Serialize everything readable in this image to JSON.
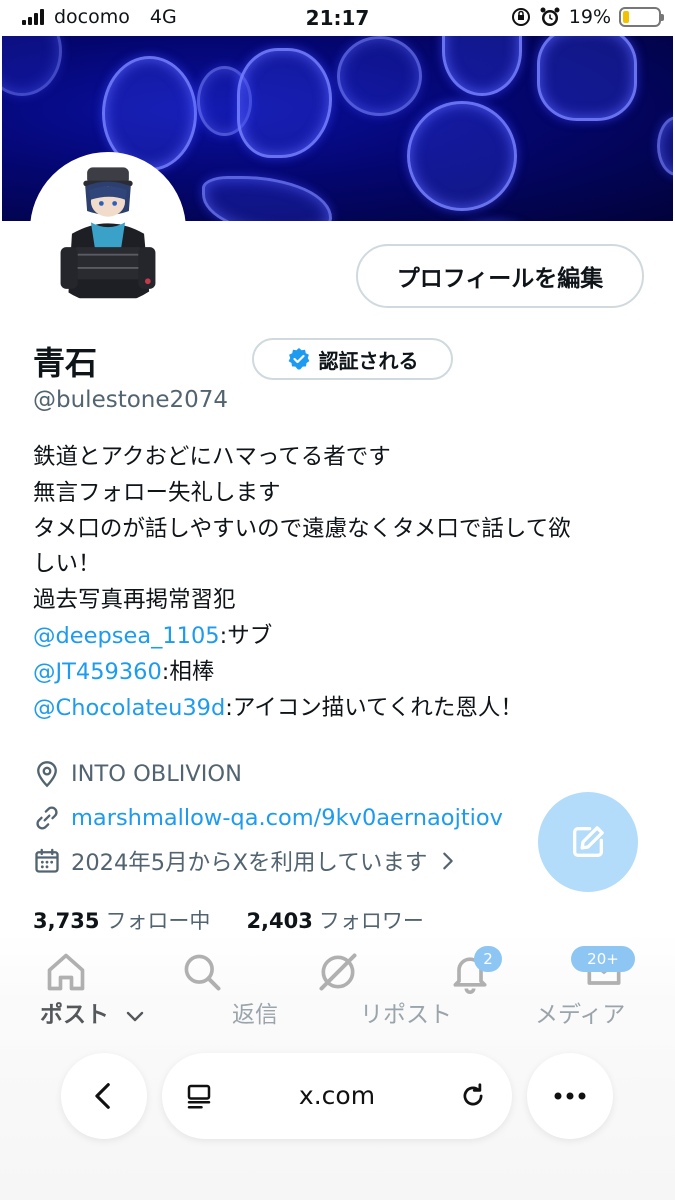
{
  "status_bar": {
    "carrier": "docomo",
    "network": "4G",
    "time": "21:17",
    "battery_percent": "19%",
    "battery_level": 0.19
  },
  "profile": {
    "edit_button": "プロフィールを編集",
    "name": "青石",
    "verify_button": "認証される",
    "handle": "@bulestone2074",
    "bio_lines": [
      [
        {
          "text": "鉄道とアクおどにハマってる者です"
        }
      ],
      [
        {
          "text": "無言フォロー失礼します"
        }
      ],
      [
        {
          "text": "タメ口のが話しやすいので遠慮なくタメ口で話して欲"
        }
      ],
      [
        {
          "text": "しい！"
        }
      ],
      [
        {
          "text": "過去写真再掲常習犯"
        }
      ],
      [
        {
          "text": "@deepsea_1105",
          "mention": true
        },
        {
          "text": ":サブ"
        }
      ],
      [
        {
          "text": "@JT459360",
          "mention": true
        },
        {
          "text": ":相棒"
        }
      ],
      [
        {
          "text": "@Chocolateu39d",
          "mention": true
        },
        {
          "text": ":アイコン描いてくれた恩人！"
        }
      ]
    ],
    "location": "INTO OBLIVION",
    "website": "marshmallow-qa.com/9kv0aernaojtiov",
    "joined": "2024年5月からXを利用しています",
    "following_count": "3,735",
    "following_label": "フォロー中",
    "followers_count": "2,403",
    "followers_label": "フォロワー"
  },
  "tabs": {
    "posts": "ポスト",
    "replies": "返信",
    "reposts": "リポスト",
    "media": "メディア"
  },
  "nav_badges": {
    "notifications": "2",
    "messages": "20+"
  },
  "browser": {
    "url": "x.com"
  },
  "colors": {
    "accent": "#1d9bf0",
    "verified_badge": "#1d9bf0",
    "banner": "#040670"
  }
}
